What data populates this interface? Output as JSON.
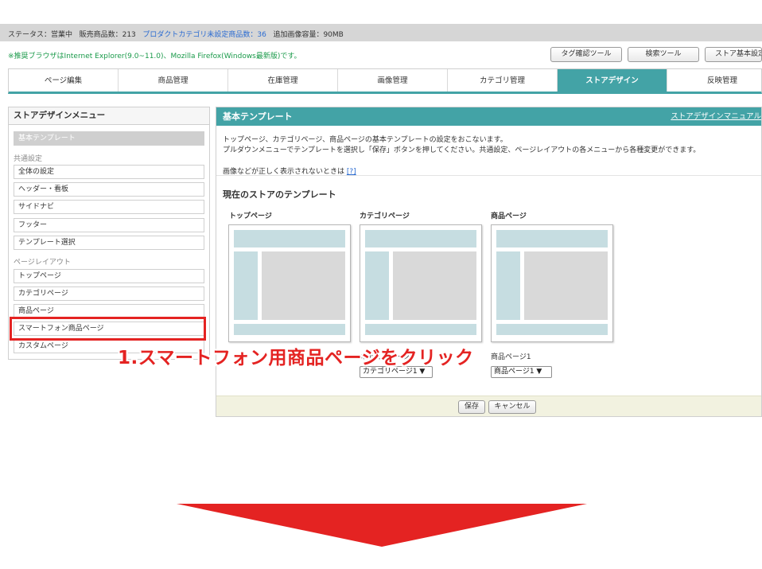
{
  "status_bar": {
    "status": "ステータス：営業中",
    "product_count": "販売商品数：213",
    "uncategorized": "プロダクトカテゴリ未設定商品数：36",
    "image_capacity": "追加画像容量：90MB"
  },
  "notice": "※推奨ブラウザはInternet Explorer(9.0~11.0)、Mozilla Firefox(Windows最新版)です。",
  "tools": [
    "タグ確認ツール",
    "検索ツール",
    "ストア基本設定"
  ],
  "tabs": [
    "ページ編集",
    "商品管理",
    "在庫管理",
    "画像管理",
    "カテゴリ管理",
    "ストアデザイン",
    "反映管理"
  ],
  "sidebar": {
    "title": "ストアデザインメニュー",
    "selected": "基本テンプレート",
    "group1": "共通設定",
    "group1_items": [
      "全体の設定",
      "ヘッダー・看板",
      "サイドナビ",
      "フッター",
      "テンプレート選択"
    ],
    "group2": "ページレイアウト",
    "group2_items": [
      "トップページ",
      "カテゴリページ",
      "商品ページ",
      "スマートフォン商品ページ",
      "カスタムページ"
    ]
  },
  "main": {
    "title": "基本テンプレート",
    "manual_link": "ストアデザインマニュアル",
    "desc1": "トップページ、カテゴリページ、商品ページの基本テンプレートの設定をおこないます。",
    "desc2": "プルダウンメニューでテンプレートを選択し「保存」ボタンを押してください。共通設定、ページレイアウトの各メニューから各種変更ができます。",
    "desc3": "画像などが正しく表示されないときは",
    "help_link": "[?]",
    "section_title": "現在のストアのテンプレート",
    "columns": [
      {
        "label": "トップページ",
        "select_label": "",
        "select_value": ""
      },
      {
        "label": "カテゴリページ",
        "select_label": "カテゴリページ",
        "select_value": "カテゴリページ1 ▼"
      },
      {
        "label": "商品ページ",
        "select_label": "商品ページ1",
        "select_value": "商品ページ1 ▼"
      }
    ],
    "save": "保存",
    "cancel": "キャンセル"
  },
  "annotation": "1.スマートフォン用商品ページをクリック",
  "colors": {
    "accent": "#43a3a6",
    "highlight": "#e42322",
    "notice": "#1a9a4a"
  }
}
